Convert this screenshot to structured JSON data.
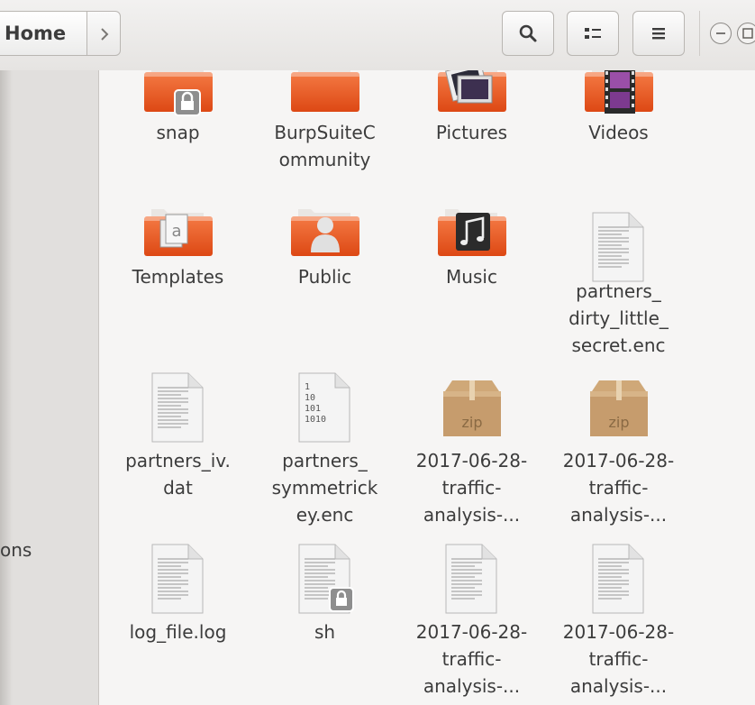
{
  "window": {
    "breadcrumb": {
      "current": "Home"
    },
    "toolbar": {
      "search_icon": "search-icon",
      "view_icon": "grid-view-icon",
      "menu_icon": "hamburger-menu-icon"
    }
  },
  "sidebar": {
    "visible_text": "ons"
  },
  "files": [
    {
      "name": "snap",
      "lines": [
        "snap"
      ],
      "type": "folder",
      "emblem": "lock"
    },
    {
      "name": "BurpSuiteCommunity",
      "lines": [
        "BurpSuiteC",
        "ommunity"
      ],
      "type": "folder",
      "emblem": "none"
    },
    {
      "name": "Pictures",
      "lines": [
        "Pictures"
      ],
      "type": "folder",
      "emblem": "pictures"
    },
    {
      "name": "Videos",
      "lines": [
        "Videos"
      ],
      "type": "folder",
      "emblem": "film"
    },
    {
      "name": "Templates",
      "lines": [
        "Templates"
      ],
      "type": "folder",
      "emblem": "template"
    },
    {
      "name": "Public",
      "lines": [
        "Public"
      ],
      "type": "folder",
      "emblem": "person"
    },
    {
      "name": "Music",
      "lines": [
        "Music"
      ],
      "type": "folder",
      "emblem": "music"
    },
    {
      "name": "partners_dirty_little_secret.enc",
      "lines": [
        "partners_",
        "dirty_little_",
        "secret.enc"
      ],
      "type": "text-file"
    },
    {
      "name": "partners_iv.dat",
      "lines": [
        "partners_iv.",
        "dat"
      ],
      "type": "text-file"
    },
    {
      "name": "partners_symmetrickey.enc",
      "lines": [
        "partners_",
        "symmetrick",
        "ey.enc"
      ],
      "type": "binary-file",
      "binary_text": [
        "1",
        "10",
        "101",
        "1010"
      ]
    },
    {
      "name": "2017-06-28-traffic-analysis-... (zip 1)",
      "lines": [
        "2017-06-28-",
        "traffic-",
        "analysis-..."
      ],
      "type": "zip",
      "badge": "zip"
    },
    {
      "name": "2017-06-28-traffic-analysis-... (zip 2)",
      "lines": [
        "2017-06-28-",
        "traffic-",
        "analysis-..."
      ],
      "type": "zip",
      "badge": "zip"
    },
    {
      "name": "log_file.log",
      "lines": [
        "log_file.log"
      ],
      "type": "text-file"
    },
    {
      "name": "sh",
      "lines": [
        "sh"
      ],
      "type": "text-file",
      "emblem": "lock"
    },
    {
      "name": "2017-06-28-traffic-analysis-... (file 1)",
      "lines": [
        "2017-06-28-",
        "traffic-",
        "analysis-..."
      ],
      "type": "text-file"
    },
    {
      "name": "2017-06-28-traffic-analysis-... (file 2)",
      "lines": [
        "2017-06-28-",
        "traffic-",
        "analysis-..."
      ],
      "type": "text-file"
    }
  ]
}
